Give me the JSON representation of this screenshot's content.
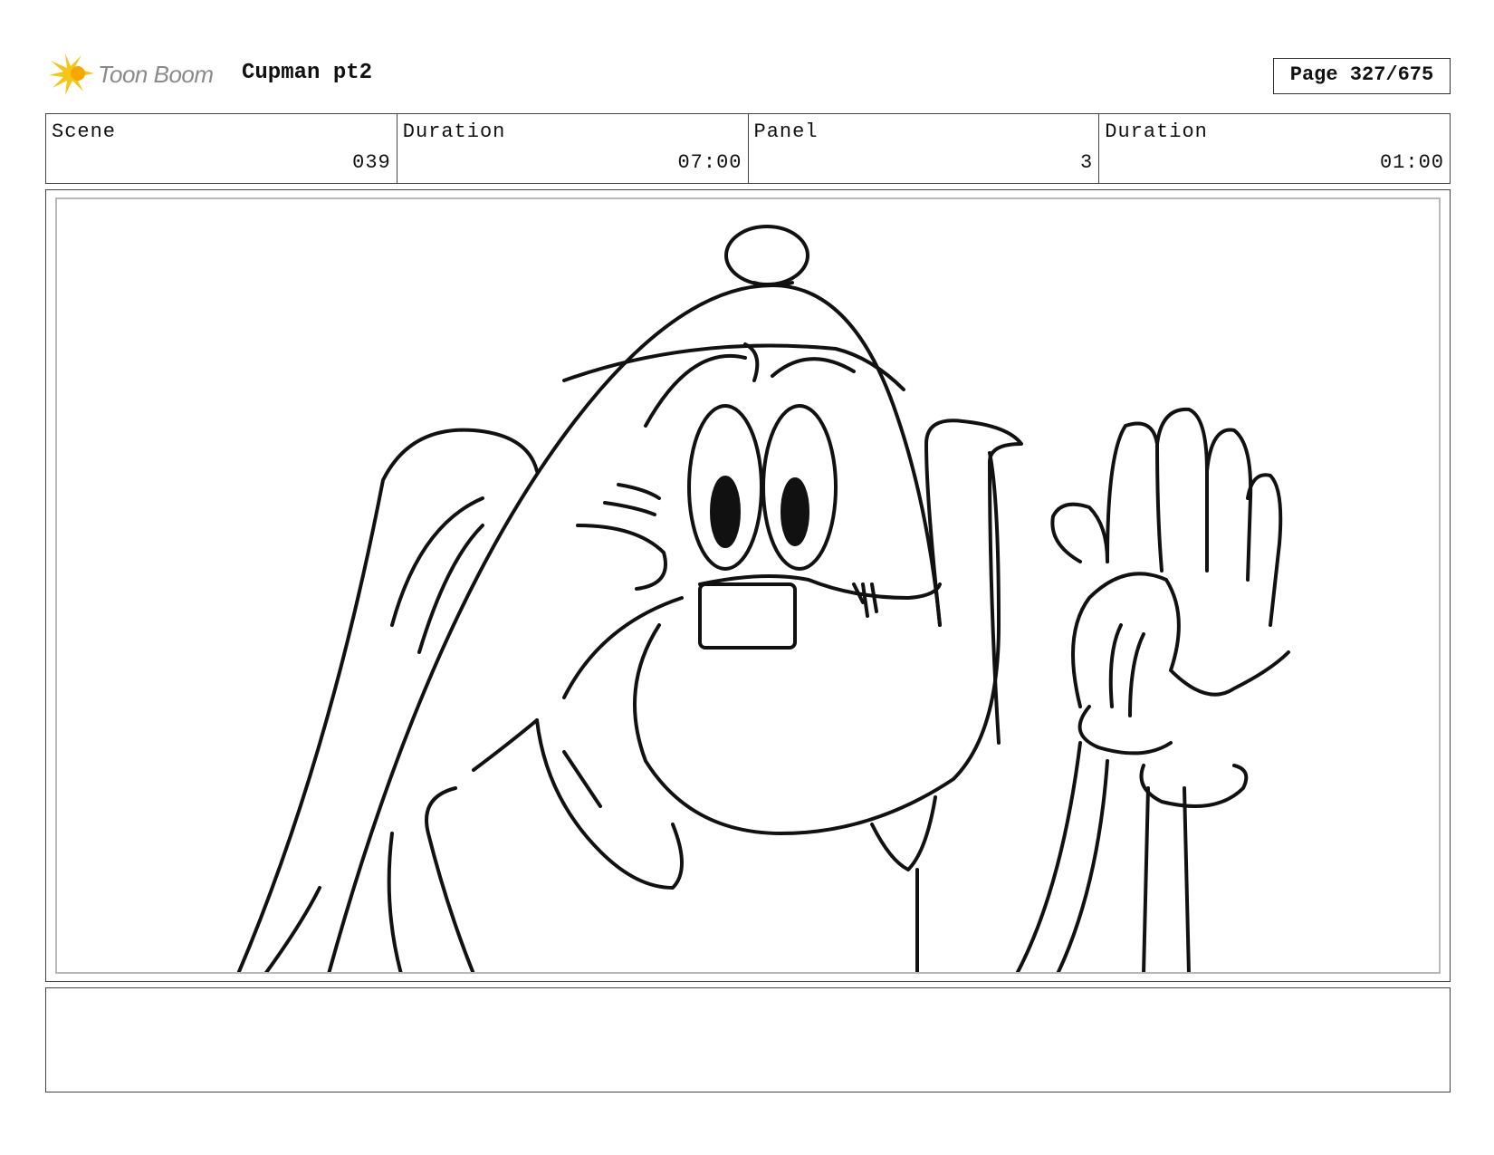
{
  "header": {
    "logo_text": "Toon Boom",
    "project_title": "Cupman pt2",
    "page_label": "Page 327/675"
  },
  "info": {
    "scene_label": "Scene",
    "scene_value": "039",
    "scene_duration_label": "Duration",
    "scene_duration_value": "07:00",
    "panel_label": "Panel",
    "panel_value": "3",
    "panel_duration_label": "Duration",
    "panel_duration_value": "01:00"
  },
  "notes": {
    "text": ""
  },
  "colors": {
    "logo_star": "#f5c518",
    "logo_text": "#8a8a8a",
    "frame_border": "#444444"
  }
}
